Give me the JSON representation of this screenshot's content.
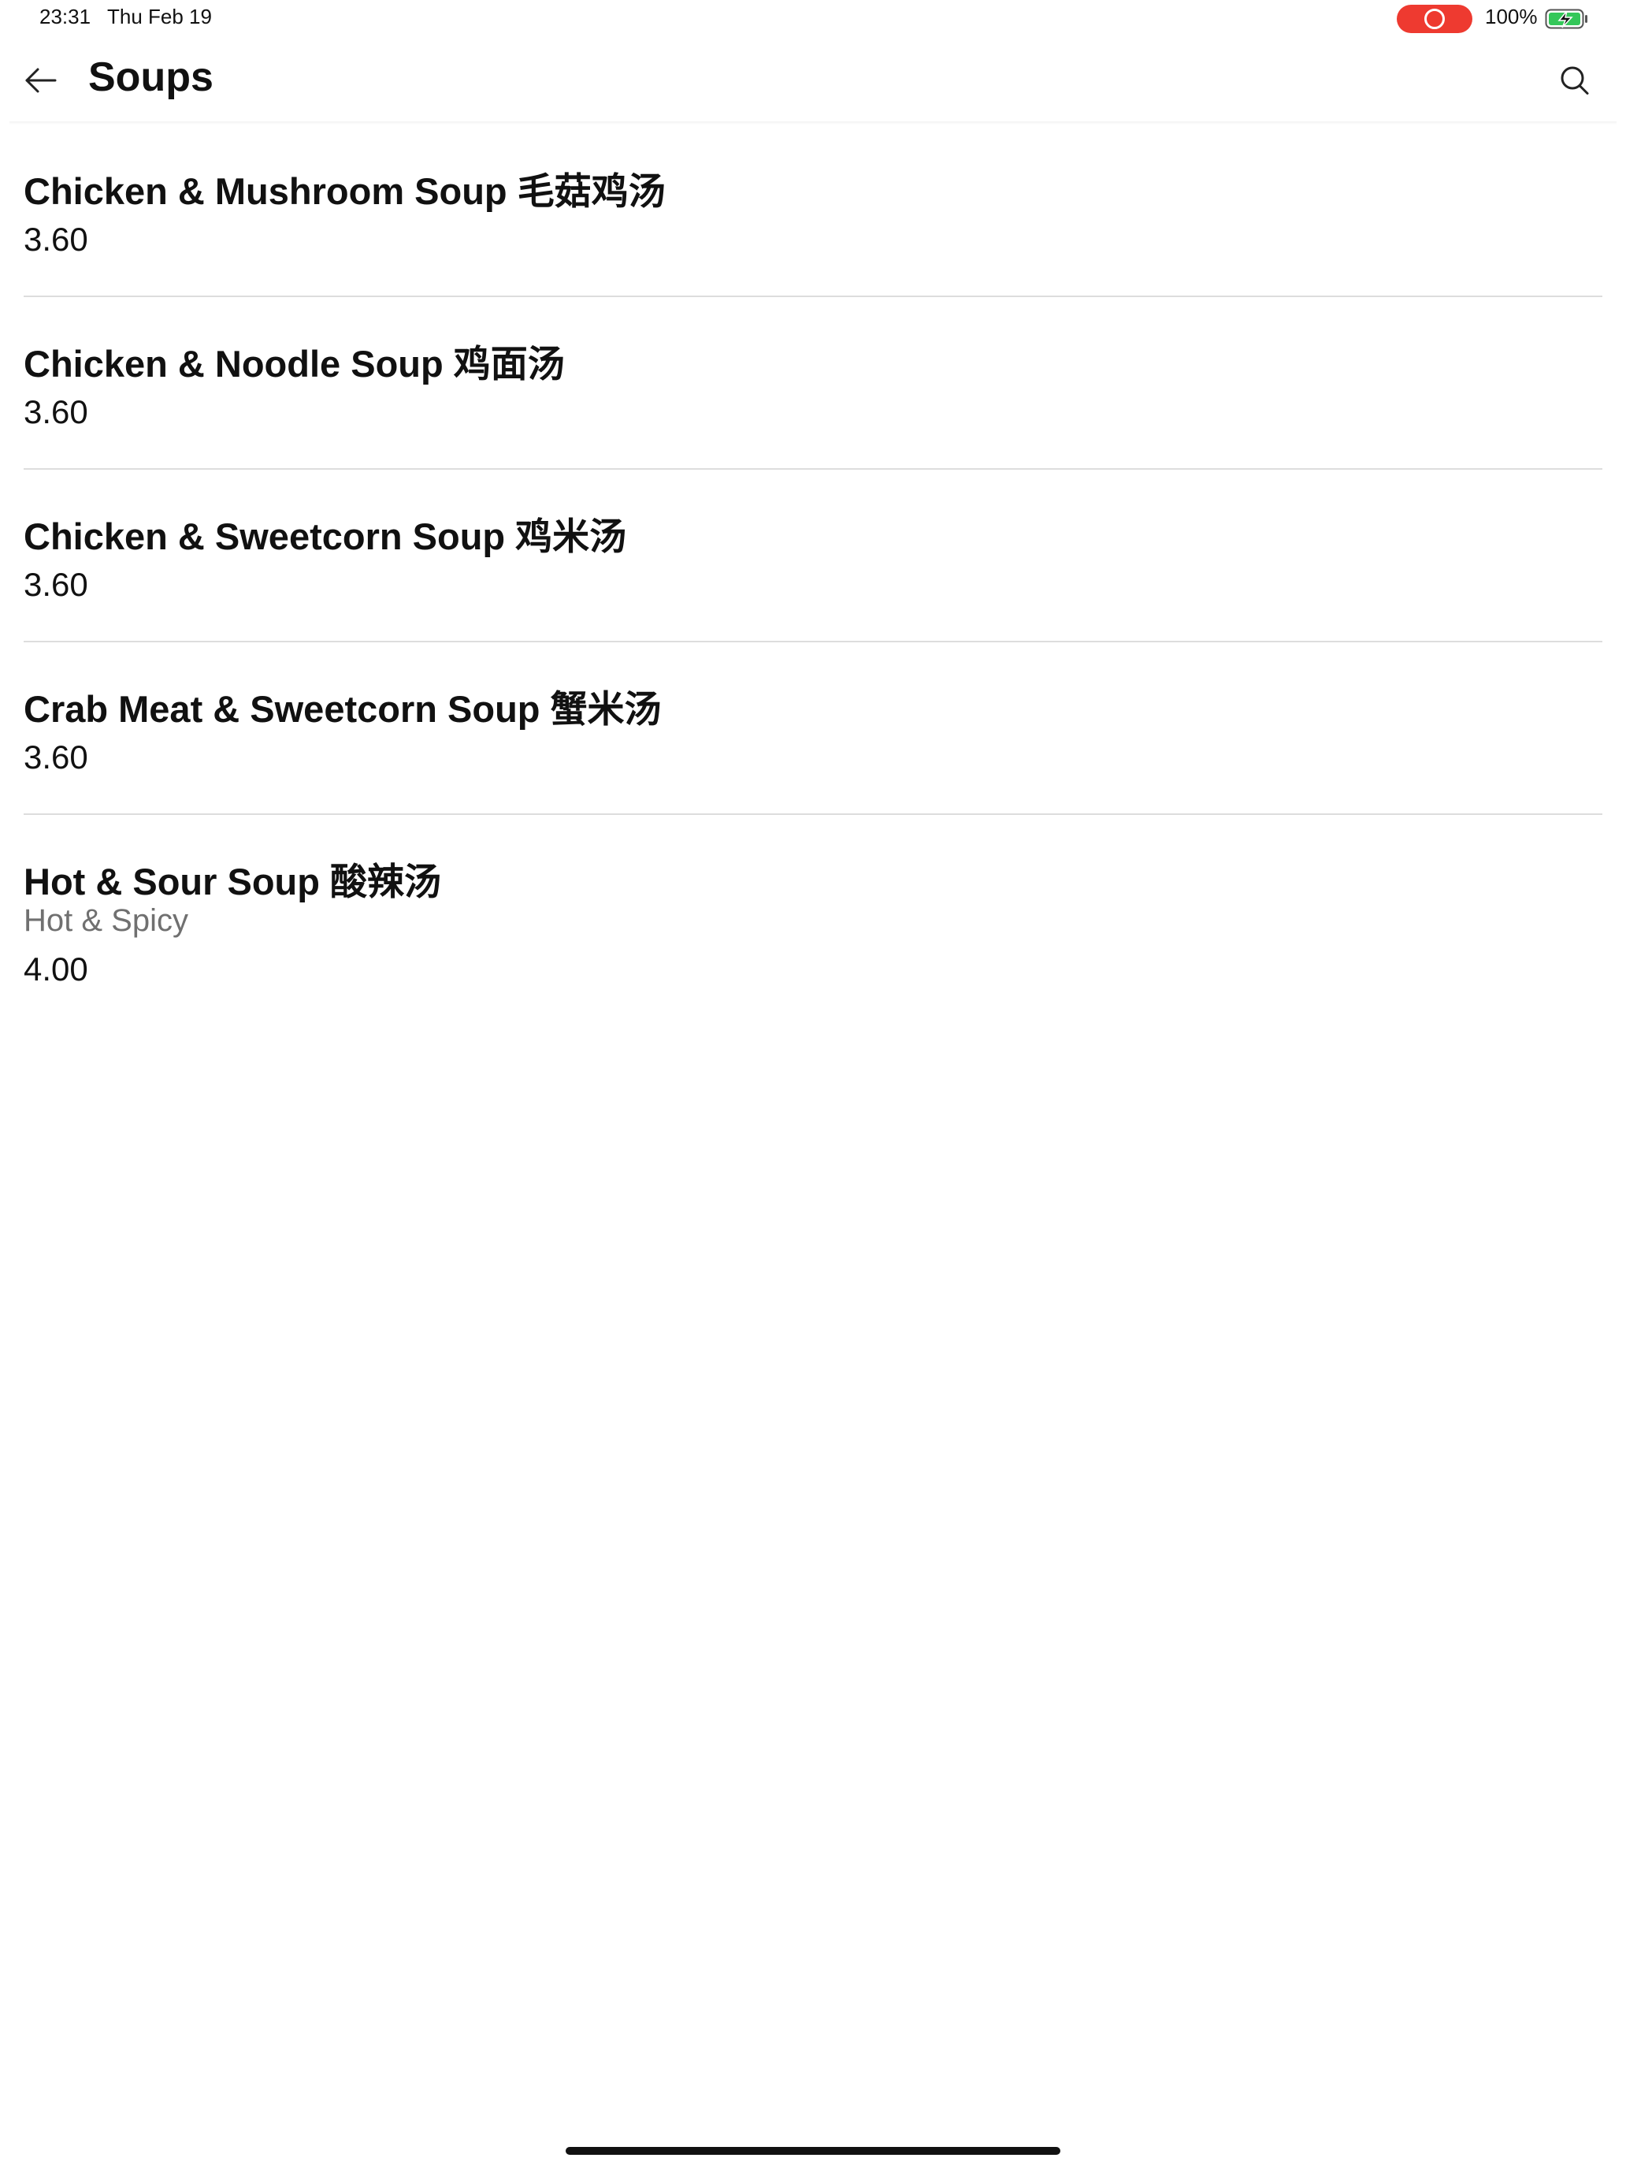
{
  "status_bar": {
    "time": "23:31",
    "date": "Thu Feb 19",
    "battery": "100%",
    "record_color": "#ee3a30",
    "battery_color": "#34c759"
  },
  "header": {
    "title": "Soups",
    "back_icon": "arrow-left-icon",
    "search_icon": "search-icon"
  },
  "menu": {
    "items": [
      {
        "name": "Chicken & Mushroom Soup 毛菇鸡汤",
        "price": "3.60"
      },
      {
        "name": "Chicken & Noodle Soup 鸡面汤",
        "price": "3.60"
      },
      {
        "name": "Chicken & Sweetcorn Soup 鸡米汤",
        "price": "3.60"
      },
      {
        "name": "Crab Meat & Sweetcorn Soup 蟹米汤",
        "price": "3.60"
      },
      {
        "name": "Hot & Sour Soup 酸辣汤",
        "description": "Hot & Spicy",
        "price": "4.00"
      }
    ]
  }
}
